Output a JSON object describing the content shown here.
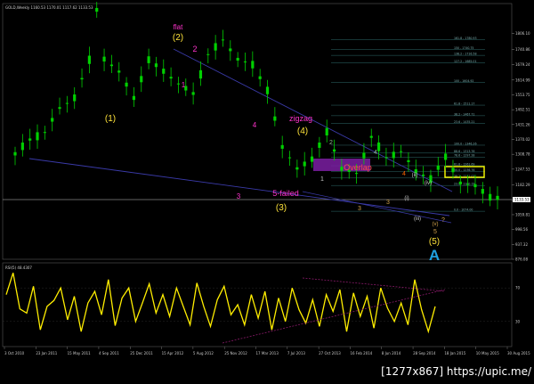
{
  "chart_data": [
    {
      "type": "candlestick",
      "panel": "price",
      "symbol_header": "GOLD,Weekly  1160.53 1170.01 1117.62 1133.53",
      "current_price_label": "1133.53",
      "y_ticks": [
        "1806.10",
        "1740.86",
        "1679.24",
        "1614.99",
        "1553.75",
        "1492.51",
        "1431.26",
        "1370.02",
        "1308.78",
        "1247.53",
        "1182.29",
        "1121.05",
        "1059.81",
        "998.56",
        "937.32",
        "876.08"
      ],
      "ylim": [
        876.08,
        1930
      ],
      "x_ticks": [
        "3 Oct 2010",
        "23 Jan 2011",
        "15 May 2011",
        "4 Sep 2011",
        "25 Dec 2011",
        "15 Apr 2012",
        "5 Aug 2012",
        "25 Nov 2012",
        "17 Mar 2013",
        "7 Jul 2013",
        "27 Oct 2013",
        "16 Feb 2014",
        "8 Jun 2014",
        "28 Sep 2014",
        "18 Jan 2015",
        "10 May 2015",
        "30 Aug 2015"
      ],
      "series": [
        {
          "x_index": 0,
          "close": 1310
        },
        {
          "x_index": 2,
          "close": 1370
        },
        {
          "x_index": 4,
          "close": 1400
        },
        {
          "x_index": 6,
          "close": 1500
        },
        {
          "x_index": 8,
          "close": 1540
        },
        {
          "x_index": 10,
          "close": 1700
        },
        {
          "x_index": 11,
          "close": 1905
        },
        {
          "x_index": 12,
          "close": 1700
        },
        {
          "x_index": 14,
          "close": 1650
        },
        {
          "x_index": 16,
          "close": 1540
        },
        {
          "x_index": 18,
          "close": 1700
        },
        {
          "x_index": 20,
          "close": 1650
        },
        {
          "x_index": 22,
          "close": 1600
        },
        {
          "x_index": 24,
          "close": 1560
        },
        {
          "x_index": 26,
          "close": 1720
        },
        {
          "x_index": 28,
          "close": 1780
        },
        {
          "x_index": 30,
          "close": 1700
        },
        {
          "x_index": 32,
          "close": 1680
        },
        {
          "x_index": 34,
          "close": 1570
        },
        {
          "x_index": 36,
          "close": 1340
        },
        {
          "x_index": 38,
          "close": 1250
        },
        {
          "x_index": 40,
          "close": 1290
        },
        {
          "x_index": 42,
          "close": 1400
        },
        {
          "x_index": 44,
          "close": 1250
        },
        {
          "x_index": 46,
          "close": 1230
        },
        {
          "x_index": 48,
          "close": 1380
        },
        {
          "x_index": 50,
          "close": 1295
        },
        {
          "x_index": 52,
          "close": 1320
        },
        {
          "x_index": 54,
          "close": 1240
        },
        {
          "x_index": 56,
          "close": 1205
        },
        {
          "x_index": 58,
          "close": 1300
        },
        {
          "x_index": 60,
          "close": 1190
        },
        {
          "x_index": 62,
          "close": 1180
        },
        {
          "x_index": 64,
          "close": 1130
        }
      ],
      "fib_levels": [
        {
          "label": "161.8 - 1780.93",
          "value": 1780.93
        },
        {
          "label": "150 - 1740.75",
          "value": 1740.75
        },
        {
          "label": "138.2 - 1716.58",
          "value": 1716.58
        },
        {
          "label": "127.2 - 1685.01",
          "value": 1685.01
        },
        {
          "label": "100 - 1604.92",
          "value": 1604.92
        },
        {
          "label": "61.8 - 1511.17",
          "value": 1511.17
        },
        {
          "label": "38.2 - 1467.71",
          "value": 1467.71
        },
        {
          "label": "23.6 - 1435.21",
          "value": 1435.21
        },
        {
          "label": "100.0 - 1346.26",
          "value": 1346.26
        },
        {
          "label": "88.6 - 1313.76",
          "value": 1313.76
        },
        {
          "label": "78.6 - 1297.28",
          "value": 1297.28
        },
        {
          "label": "61.8 - 1261.69",
          "value": 1261.69
        },
        {
          "label": "50.0 - 1236.76",
          "value": 1236.76
        },
        {
          "label": "38.2 - 1211.02",
          "value": 1211.02
        },
        {
          "label": "23.6 - 1180.19",
          "value": 1180.19
        },
        {
          "label": "0.0 - 1074.00",
          "value": 1074.0
        }
      ],
      "wave_labels": [
        {
          "text": "flat",
          "color": "#ff33cc"
        },
        {
          "text": "(2)",
          "color": "#ffe33a"
        },
        {
          "text": "2",
          "color": "#ff33cc"
        },
        {
          "text": "1",
          "color": "#ff33cc"
        },
        {
          "text": "(1)",
          "color": "#ffe33a"
        },
        {
          "text": "zigzag",
          "color": "#ff33cc"
        },
        {
          "text": "(4)",
          "color": "#ffe33a"
        },
        {
          "text": "4",
          "color": "#ff33cc"
        },
        {
          "text": "3",
          "color": "#ff33cc"
        },
        {
          "text": "5-failed",
          "color": "#ff33cc"
        },
        {
          "text": "(3)",
          "color": "#ffe33a"
        },
        {
          "text": "Overlap",
          "color": "#ff4d4d"
        },
        {
          "text": "2",
          "color": "#8fbc8f"
        },
        {
          "text": "4",
          "color": "#8fbc8f"
        },
        {
          "text": "1",
          "color": "#c8c8c8"
        },
        {
          "text": "3",
          "color": "#d2a24c"
        },
        {
          "text": "3",
          "color": "#d2a24c"
        },
        {
          "text": "4",
          "color": "#ff6600"
        },
        {
          "text": "(ii)",
          "color": "#c8c8c8"
        },
        {
          "text": "(iv)",
          "color": "#c8c8c8"
        },
        {
          "text": "(i)",
          "color": "#c8c8c8"
        },
        {
          "text": "(iii)",
          "color": "#c8c8c8"
        },
        {
          "text": "(v)",
          "color": "#d2a24c"
        },
        {
          "text": "?",
          "color": "#d2a24c"
        },
        {
          "text": "5",
          "color": "#d2a24c"
        },
        {
          "text": "(5)",
          "color": "#ffe33a"
        },
        {
          "text": "A",
          "color": "#1fa0e0"
        }
      ],
      "colors": {
        "candles": "#00d000",
        "trendlines": "#3a3aa8",
        "overlap_box": "#7b1fa2",
        "highlight_box": "#ffff00",
        "current_price_line": "#c8c8c8"
      }
    },
    {
      "type": "line",
      "panel": "indicator",
      "header": "RSI(5) 48.4307",
      "y_ticks": [
        "70",
        "30"
      ],
      "ylim": [
        0,
        100
      ],
      "x_ticks": [
        "3 Oct 2010",
        "23 Jan 2011",
        "15 May 2011",
        "4 Sep 2011",
        "25 Dec 2011",
        "15 Apr 2012",
        "5 Aug 2012",
        "25 Nov 2012",
        "17 Mar 2013",
        "7 Jul 2013",
        "27 Oct 2013",
        "16 Feb 2014",
        "8 Jun 2014",
        "28 Sep 2014",
        "18 Jan 2015",
        "10 May 2015",
        "30 Aug 2015"
      ],
      "series": [
        {
          "values": [
            62,
            88,
            45,
            40,
            72,
            20,
            48,
            55,
            70,
            32,
            60,
            18,
            52,
            66,
            38,
            80,
            25,
            58,
            70,
            30,
            52,
            75,
            40,
            62,
            36,
            70,
            48,
            26,
            76,
            48,
            24,
            56,
            72,
            38,
            50,
            26,
            62,
            34,
            66,
            20,
            58,
            30,
            70,
            44,
            28,
            56,
            24,
            62,
            42,
            68,
            18,
            64,
            36,
            60,
            22,
            70,
            46,
            30,
            52,
            26,
            80,
            44,
            18,
            48
          ]
        }
      ],
      "colors": {
        "line": "#ffee00",
        "trendline": "#8a1a6a"
      }
    }
  ],
  "watermark": "[1277x867] https://upic.me/"
}
